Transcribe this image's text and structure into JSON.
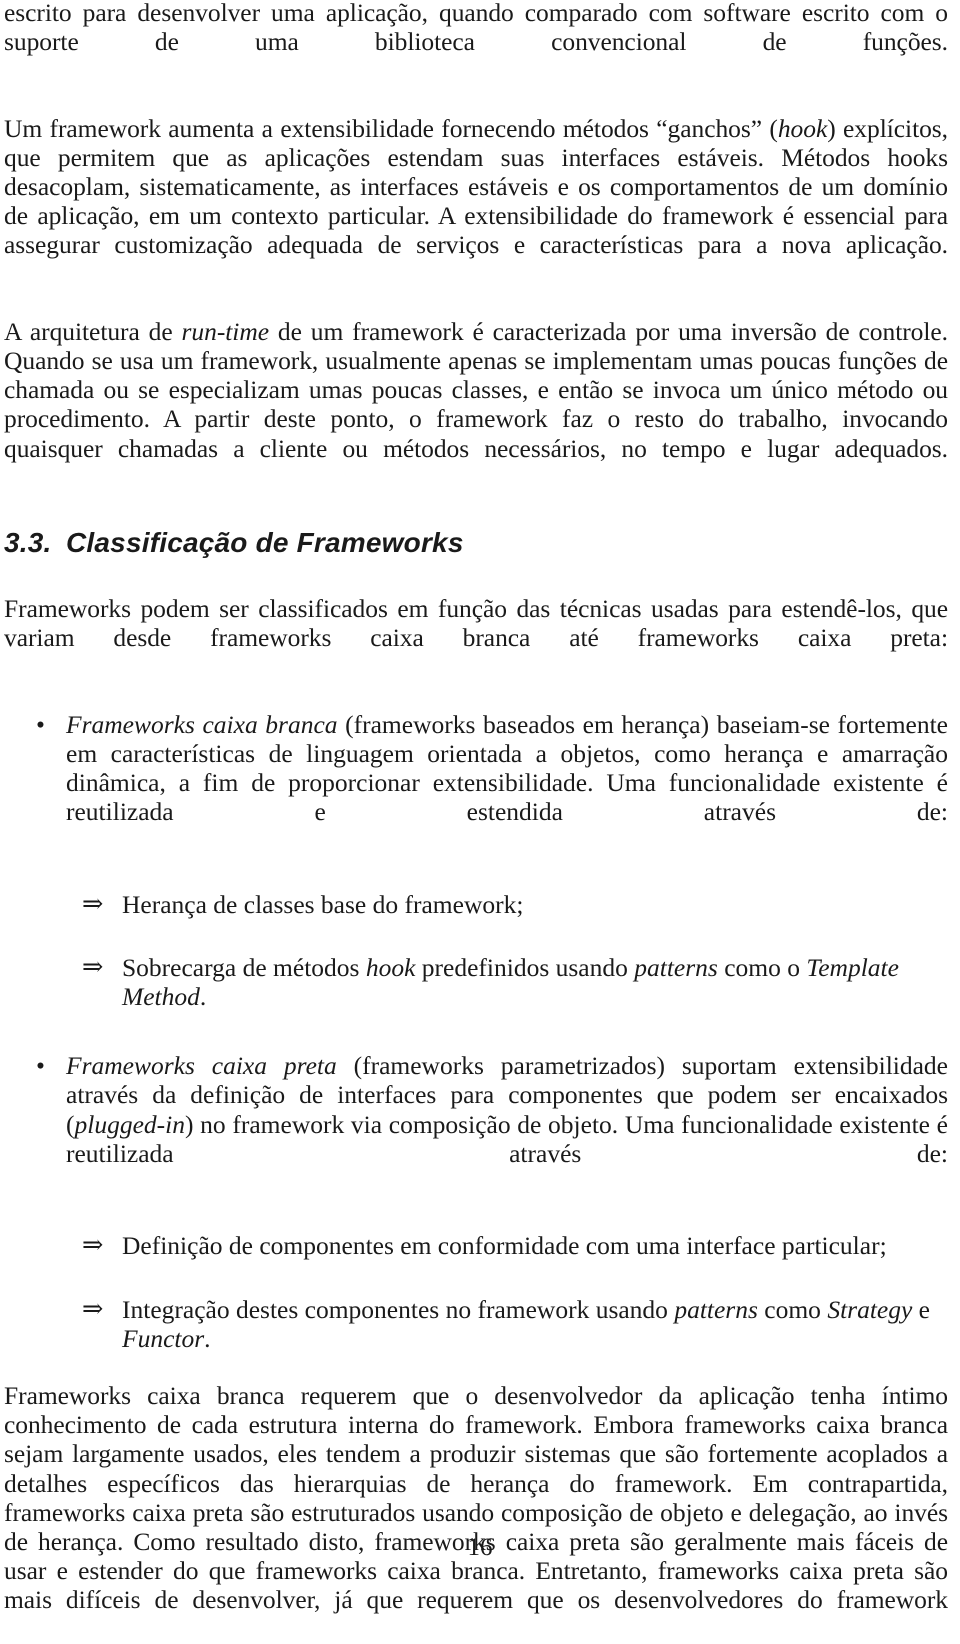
{
  "document": {
    "page_number": "16",
    "language": "pt-BR"
  },
  "blocks": {
    "para_continuation": "escrito para desenvolver uma aplicação, quando comparado com software escrito com o suporte de uma biblioteca convencional de funções.",
    "para_hooks_1": "Um framework aumenta a extensibilidade fornecendo métodos “ganchos” (",
    "para_hooks_1_em": "hook",
    "para_hooks_1_cont": ") explícitos, que permitem que as aplicações estendam suas interfaces estáveis. Métodos hooks desacoplam, sistematicamente, as interfaces estáveis e os comportamentos de um domínio de aplicação, em um contexto particular. A extensibilidade do framework é essencial para assegurar customização adequada de serviços e características para a nova aplicação.",
    "para_runtime_1": "A arquitetura de ",
    "para_runtime_em": "run-time",
    "para_runtime_2": " de um framework é caracterizada por uma inversão de controle. Quando se usa um framework, usualmente apenas se implementam umas poucas funções de chamada ou se especializam umas poucas classes, e então se invoca um único método ou procedimento. A partir deste ponto, o framework faz o resto do trabalho, invocando quaisquer chamadas a cliente ou métodos necessários, no tempo e lugar adequados."
  },
  "heading": {
    "number": "3.3.",
    "title": "Classificação de Frameworks"
  },
  "intro": {
    "text": "Frameworks podem ser classificados em função das técnicas usadas para estendê-los, que variam desde frameworks caixa branca até frameworks caixa preta:"
  },
  "bullets": [
    {
      "marker": "•",
      "em_lead": "Frameworks caixa branca",
      "text": " (frameworks baseados em herança) baseiam-se fortemente em características de linguagem orientada a objetos, como herança e amarração dinâmica, a fim de proporcionar extensibilidade. Uma funcionalidade existente é reutilizada e estendida através de:",
      "subitems": [
        {
          "marker": "⇒",
          "parts": [
            {
              "text": "Herança de classes base do framework;",
              "italic": false
            }
          ]
        },
        {
          "marker": "⇒",
          "parts": [
            {
              "text": "Sobrecarga de métodos ",
              "italic": false
            },
            {
              "text": "hook",
              "italic": true
            },
            {
              "text": " predefinidos usando ",
              "italic": false
            },
            {
              "text": "patterns",
              "italic": true
            },
            {
              "text": " como o ",
              "italic": false
            },
            {
              "text": "Template Method",
              "italic": true
            },
            {
              "text": ".",
              "italic": false
            }
          ]
        }
      ]
    },
    {
      "marker": "•",
      "em_lead": "Frameworks caixa preta",
      "text_a": " (frameworks parametrizados) suportam extensibilidade através da definição de interfaces para componentes que podem ser encaixados (",
      "em_mid": "plugged-in",
      "text_b": ") no framework via composição de objeto. Uma funcionalidade existente é reutilizada através de:",
      "subitems": [
        {
          "marker": "⇒",
          "parts": [
            {
              "text": "Definição de componentes em conformidade com uma interface particular;",
              "italic": false
            }
          ]
        },
        {
          "marker": "⇒",
          "parts": [
            {
              "text": "Integração destes componentes no framework usando ",
              "italic": false
            },
            {
              "text": "patterns",
              "italic": true
            },
            {
              "text": " como ",
              "italic": false
            },
            {
              "text": "Strategy",
              "italic": true
            },
            {
              "text": " e ",
              "italic": false
            },
            {
              "text": "Functor",
              "italic": true
            },
            {
              "text": ".",
              "italic": false
            }
          ]
        }
      ]
    }
  ],
  "closing": {
    "text": "Frameworks caixa branca requerem que o desenvolvedor da aplicação tenha íntimo conhecimento de cada estrutura interna do framework. Embora frameworks caixa branca sejam largamente usados, eles tendem a produzir sistemas que são fortemente acoplados a detalhes específicos das hierarquias de herança do framework. Em contrapartida, frameworks caixa preta são estruturados usando composição de objeto e delegação, ao invés de herança. Como resultado disto, frameworks caixa preta são geralmente mais fáceis de usar e estender do que frameworks caixa branca. Entretanto, frameworks caixa preta são mais difíceis de desenvolver, já que requerem que os desenvolvedores do framework"
  }
}
